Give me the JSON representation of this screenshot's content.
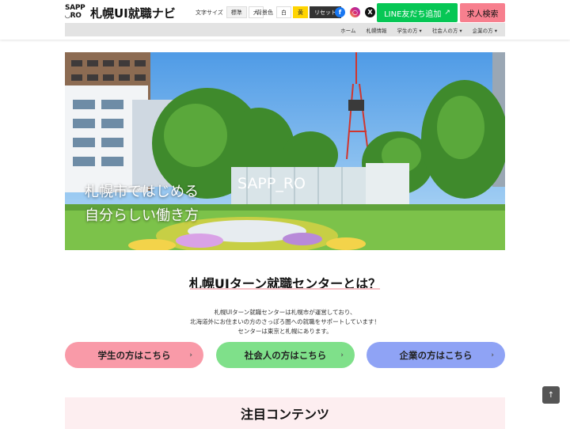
{
  "header": {
    "logo_mark": "SAPP\nRO",
    "logo_title": "札幌UI就職ナビ",
    "font_size_label": "文字サイズ",
    "font_size_standard": "標準",
    "font_size_large": "大",
    "bg_color_label": "背景色",
    "bg_white": "白",
    "bg_yellow": "黄",
    "reset": "リセット",
    "line_button": "LINE友だち追加",
    "job_search_button": "求人検索"
  },
  "nav": {
    "items": [
      "ホーム",
      "札幌情報",
      "学生の方 ▾",
      "社会人の方 ▾",
      "企業の方 ▾"
    ]
  },
  "hero": {
    "line1": "札幌市ではじめる",
    "line2": "自分らしい働き方",
    "sign_text": "SAPP_RO"
  },
  "about": {
    "title": "札幌UIターン就職センターとは？",
    "desc1": "札幌UIターン就職センターは札幌市が運営しており、",
    "desc2": "北海道外にお住まいの方のさっぽろ圏への就職をサポートしています！",
    "desc3": "センターは東京と札幌にあります。"
  },
  "ctas": {
    "student": "学生の方はこちら",
    "worker": "社会人の方はこちら",
    "company": "企業の方はこちら",
    "chevron": "›"
  },
  "featured": {
    "title": "注目コンテンツ"
  },
  "to_top": "↑",
  "colors": {
    "line_green": "#06c755",
    "job_pink": "#f77f8e",
    "student_pink": "#f99aa8",
    "worker_green": "#7fe08a",
    "company_blue": "#8fa3f5"
  }
}
